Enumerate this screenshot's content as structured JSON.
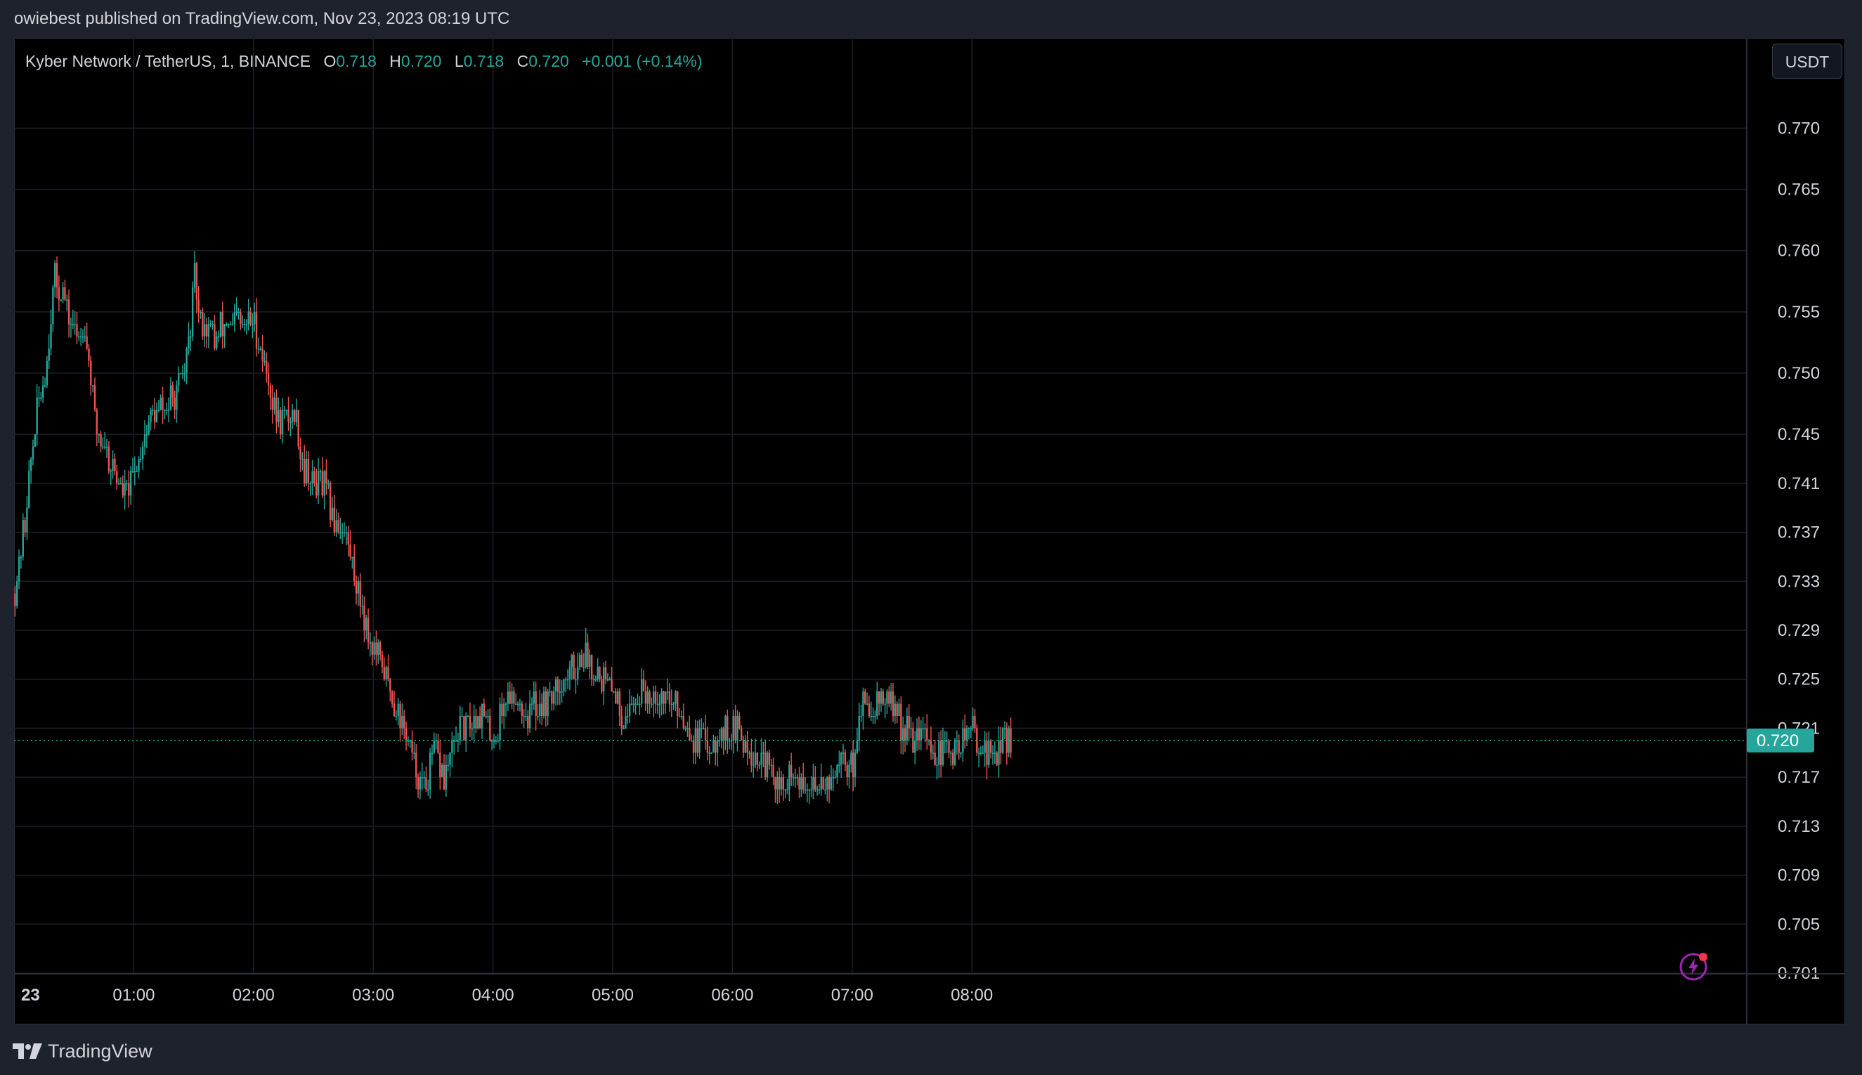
{
  "header": {
    "published_line": "owiebest published on TradingView.com, Nov 23, 2023 08:19 UTC"
  },
  "legend": {
    "symbol": "Kyber Network / TetherUS, 1, BINANCE",
    "o_label": "O",
    "o_value": "0.718",
    "h_label": "H",
    "h_value": "0.720",
    "l_label": "L",
    "l_value": "0.718",
    "c_label": "C",
    "c_value": "0.720",
    "change": "+0.001 (+0.14%)"
  },
  "toolbar": {
    "currency_label": "USDT"
  },
  "price_badge": "0.720",
  "footer": {
    "brand": "TradingView"
  },
  "icons": {
    "brand_logo": "tradingview-logo-icon",
    "snapshot": "lightning-icon"
  },
  "colors": {
    "up": "#26a69a",
    "down": "#ef5350",
    "background": "#000000",
    "grid": "#1c1f26",
    "text": "#d1d4dc",
    "accent": "#9c27b0"
  },
  "chart_data": {
    "type": "candlestick",
    "interval_minutes": 1,
    "session_start": "00:00",
    "session_end": "08:19",
    "last_price": 0.72,
    "ylim": [
      0.701,
      0.771
    ],
    "y_ticks": [
      "0.770",
      "0.765",
      "0.760",
      "0.755",
      "0.750",
      "0.745",
      "0.741",
      "0.737",
      "0.733",
      "0.729",
      "0.725",
      "0.721",
      "0.717",
      "0.713",
      "0.709",
      "0.705",
      "0.701"
    ],
    "x_ticks": [
      "23",
      "01:00",
      "02:00",
      "03:00",
      "04:00",
      "05:00",
      "06:00",
      "07:00",
      "08:00"
    ],
    "grid": true,
    "path": [
      {
        "t": "00:00",
        "p": 0.732
      },
      {
        "t": "00:05",
        "p": 0.738
      },
      {
        "t": "00:10",
        "p": 0.746
      },
      {
        "t": "00:15",
        "p": 0.75
      },
      {
        "t": "00:20",
        "p": 0.758
      },
      {
        "t": "00:25",
        "p": 0.756
      },
      {
        "t": "00:30",
        "p": 0.753
      },
      {
        "t": "00:35",
        "p": 0.754
      },
      {
        "t": "00:40",
        "p": 0.746
      },
      {
        "t": "00:45",
        "p": 0.744
      },
      {
        "t": "00:50",
        "p": 0.742
      },
      {
        "t": "00:55",
        "p": 0.74
      },
      {
        "t": "01:00",
        "p": 0.742
      },
      {
        "t": "01:05",
        "p": 0.745
      },
      {
        "t": "01:10",
        "p": 0.747
      },
      {
        "t": "01:15",
        "p": 0.747
      },
      {
        "t": "01:20",
        "p": 0.748
      },
      {
        "t": "01:25",
        "p": 0.75
      },
      {
        "t": "01:28",
        "p": 0.754
      },
      {
        "t": "01:30",
        "p": 0.758
      },
      {
        "t": "01:32",
        "p": 0.755
      },
      {
        "t": "01:35",
        "p": 0.754
      },
      {
        "t": "01:40",
        "p": 0.753
      },
      {
        "t": "01:45",
        "p": 0.754
      },
      {
        "t": "01:50",
        "p": 0.754
      },
      {
        "t": "01:55",
        "p": 0.754
      },
      {
        "t": "02:00",
        "p": 0.754
      },
      {
        "t": "02:05",
        "p": 0.751
      },
      {
        "t": "02:10",
        "p": 0.747
      },
      {
        "t": "02:15",
        "p": 0.746
      },
      {
        "t": "02:20",
        "p": 0.747
      },
      {
        "t": "02:25",
        "p": 0.742
      },
      {
        "t": "02:30",
        "p": 0.741
      },
      {
        "t": "02:35",
        "p": 0.741
      },
      {
        "t": "02:40",
        "p": 0.738
      },
      {
        "t": "02:45",
        "p": 0.737
      },
      {
        "t": "02:50",
        "p": 0.734
      },
      {
        "t": "02:55",
        "p": 0.73
      },
      {
        "t": "03:00",
        "p": 0.727
      },
      {
        "t": "03:05",
        "p": 0.726
      },
      {
        "t": "03:10",
        "p": 0.723
      },
      {
        "t": "03:15",
        "p": 0.721
      },
      {
        "t": "03:20",
        "p": 0.718
      },
      {
        "t": "03:25",
        "p": 0.716
      },
      {
        "t": "03:30",
        "p": 0.719
      },
      {
        "t": "03:35",
        "p": 0.717
      },
      {
        "t": "03:40",
        "p": 0.72
      },
      {
        "t": "03:45",
        "p": 0.721
      },
      {
        "t": "03:50",
        "p": 0.722
      },
      {
        "t": "03:55",
        "p": 0.722
      },
      {
        "t": "04:00",
        "p": 0.72
      },
      {
        "t": "04:05",
        "p": 0.723
      },
      {
        "t": "04:10",
        "p": 0.724
      },
      {
        "t": "04:15",
        "p": 0.722
      },
      {
        "t": "04:20",
        "p": 0.723
      },
      {
        "t": "04:25",
        "p": 0.723
      },
      {
        "t": "04:30",
        "p": 0.724
      },
      {
        "t": "04:35",
        "p": 0.725
      },
      {
        "t": "04:40",
        "p": 0.726
      },
      {
        "t": "04:45",
        "p": 0.727
      },
      {
        "t": "04:50",
        "p": 0.726
      },
      {
        "t": "04:55",
        "p": 0.725
      },
      {
        "t": "05:00",
        "p": 0.724
      },
      {
        "t": "05:05",
        "p": 0.722
      },
      {
        "t": "05:10",
        "p": 0.723
      },
      {
        "t": "05:15",
        "p": 0.724
      },
      {
        "t": "05:20",
        "p": 0.724
      },
      {
        "t": "05:25",
        "p": 0.724
      },
      {
        "t": "05:30",
        "p": 0.723
      },
      {
        "t": "05:35",
        "p": 0.722
      },
      {
        "t": "05:40",
        "p": 0.72
      },
      {
        "t": "05:45",
        "p": 0.72
      },
      {
        "t": "05:50",
        "p": 0.72
      },
      {
        "t": "05:55",
        "p": 0.721
      },
      {
        "t": "06:00",
        "p": 0.721
      },
      {
        "t": "06:05",
        "p": 0.72
      },
      {
        "t": "06:10",
        "p": 0.719
      },
      {
        "t": "06:15",
        "p": 0.718
      },
      {
        "t": "06:20",
        "p": 0.717
      },
      {
        "t": "06:25",
        "p": 0.716
      },
      {
        "t": "06:30",
        "p": 0.717
      },
      {
        "t": "06:35",
        "p": 0.716
      },
      {
        "t": "06:40",
        "p": 0.716
      },
      {
        "t": "06:45",
        "p": 0.717
      },
      {
        "t": "06:50",
        "p": 0.717
      },
      {
        "t": "06:55",
        "p": 0.718
      },
      {
        "t": "07:00",
        "p": 0.718
      },
      {
        "t": "07:02",
        "p": 0.721
      },
      {
        "t": "07:05",
        "p": 0.723
      },
      {
        "t": "07:10",
        "p": 0.723
      },
      {
        "t": "07:15",
        "p": 0.723
      },
      {
        "t": "07:20",
        "p": 0.723
      },
      {
        "t": "07:25",
        "p": 0.721
      },
      {
        "t": "07:30",
        "p": 0.72
      },
      {
        "t": "07:35",
        "p": 0.721
      },
      {
        "t": "07:40",
        "p": 0.719
      },
      {
        "t": "07:45",
        "p": 0.719
      },
      {
        "t": "07:50",
        "p": 0.719
      },
      {
        "t": "07:55",
        "p": 0.72
      },
      {
        "t": "08:00",
        "p": 0.721
      },
      {
        "t": "08:05",
        "p": 0.719
      },
      {
        "t": "08:10",
        "p": 0.719
      },
      {
        "t": "08:15",
        "p": 0.72
      },
      {
        "t": "08:19",
        "p": 0.72
      }
    ]
  }
}
